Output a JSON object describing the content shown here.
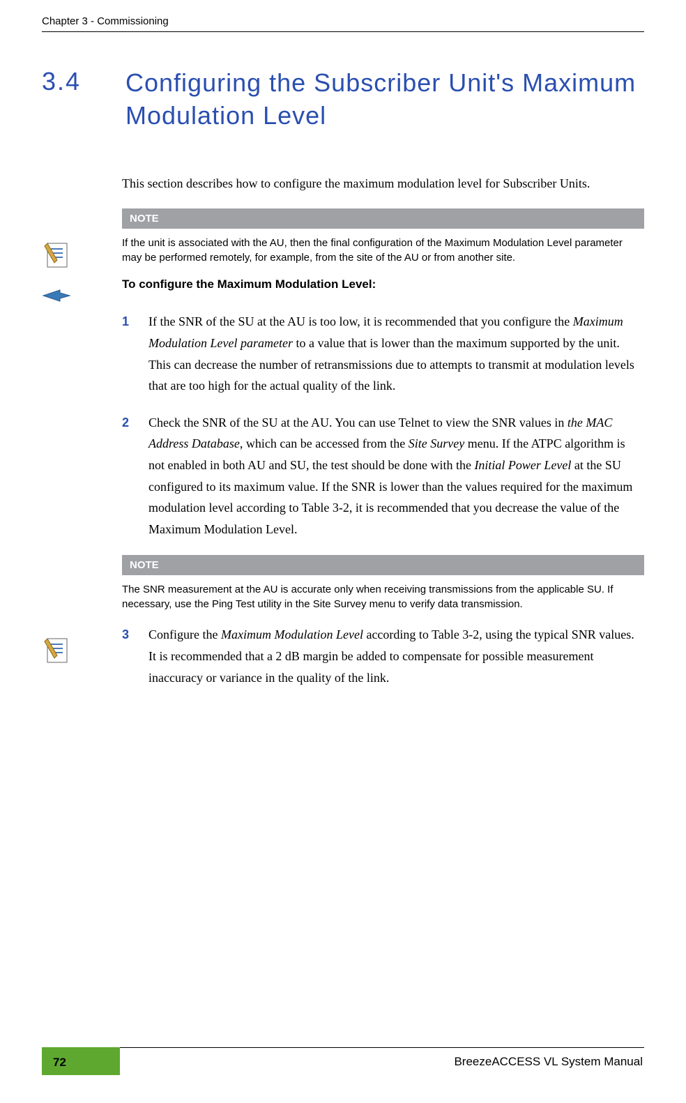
{
  "header": {
    "chapter": "Chapter 3 - Commissioning"
  },
  "section": {
    "number": "3.4",
    "title": "Configuring the Subscriber Unit's Maximum Modulation Level"
  },
  "intro": "This section describes how to configure the maximum modulation level for Subscriber Units.",
  "note1": {
    "label": "NOTE",
    "text": "If the unit is associated with the AU, then the final configuration of the Maximum Modulation Level parameter may be performed remotely, for example, from the site of the AU or from another site."
  },
  "procedure_title": "To configure the Maximum Modulation Level:",
  "step1": {
    "num": "1",
    "p1": "If the SNR of the SU at the AU is too low, it is recommended that you configure the ",
    "i1": "Maximum Modulation Level parameter",
    "p2": " to a value that is lower than the maximum supported by the unit. This can decrease the number of retransmissions due to attempts to transmit at modulation levels that are too high for the actual quality of the link."
  },
  "step2": {
    "num": "2",
    "p1": "Check the SNR of the SU at the AU. You can use Telnet to view the SNR values in ",
    "i1": "the MAC Address Database",
    "p2": ", which can be accessed from the ",
    "i2": "Site Survey",
    "p3": " menu. If the ATPC algorithm is not enabled in both AU and SU, the test should be done with the ",
    "i3": "Initial Power Level",
    "p4": " at the SU configured to its maximum value. If the SNR is lower than the values required for the maximum modulation level according to Table ",
    "ref": "3-2",
    "p5": ", it is recommended that you decrease the value of the Maximum Modulation Level."
  },
  "note2": {
    "label": "NOTE",
    "text": "The SNR measurement at the AU is accurate only when receiving transmissions from the applicable SU. If necessary, use the Ping Test utility in the Site Survey menu to verify data transmission."
  },
  "step3": {
    "num": "3",
    "p1": "Configure the ",
    "i1": "Maximum Modulation Level",
    "p2": " according to Table 3-2, using the typical SNR values. It is recommended that a 2 dB margin be added to compensate for possible measurement inaccuracy or variance in the quality of the link."
  },
  "footer": {
    "page": "72",
    "manual": "BreezeACCESS VL System Manual"
  }
}
